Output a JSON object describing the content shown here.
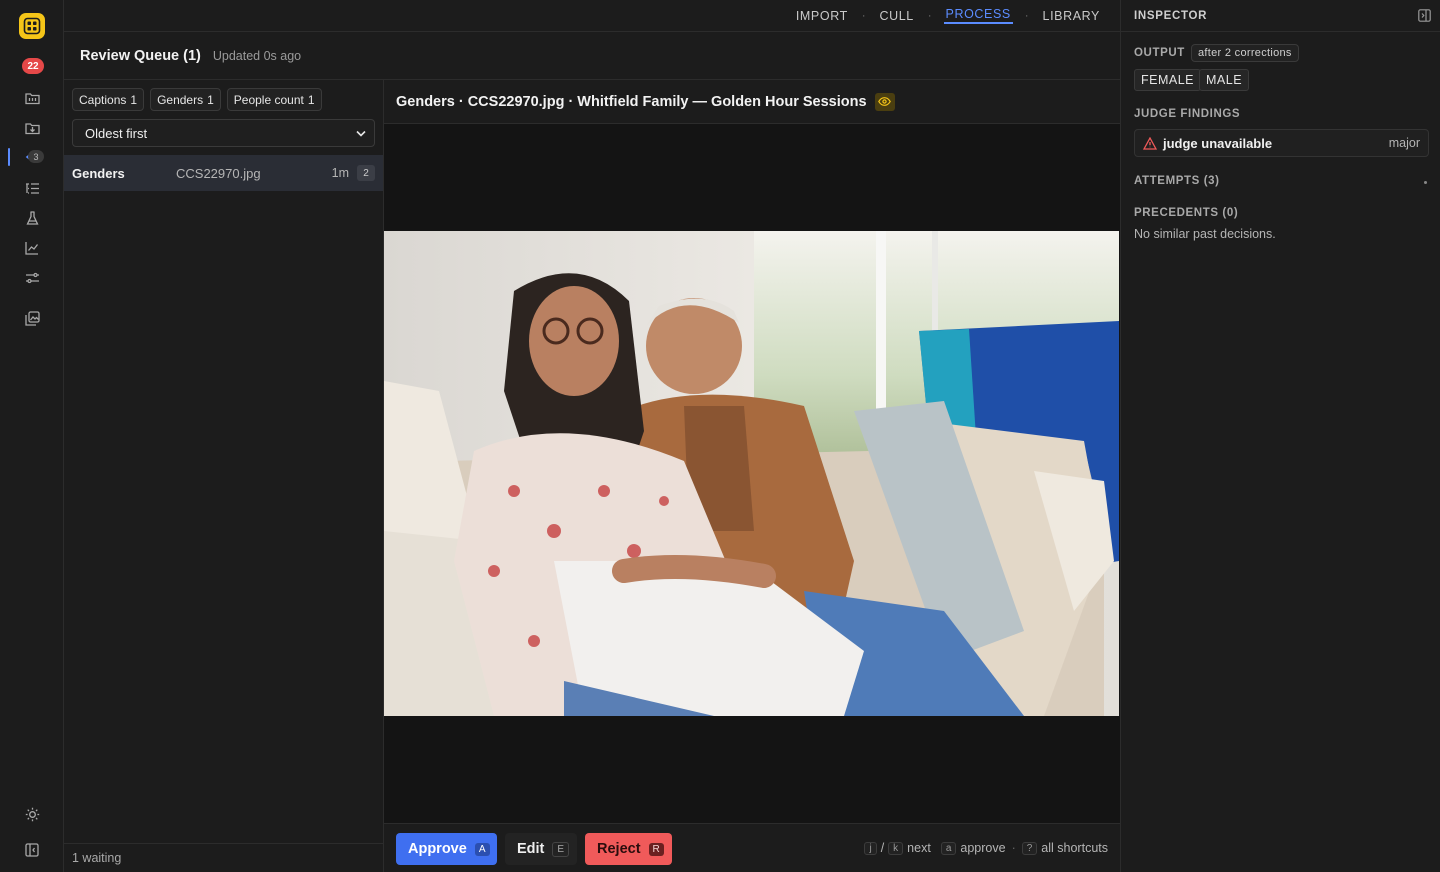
{
  "rail": {
    "notification_count": "22",
    "process_count": "3",
    "colors": {
      "logo": "#f5c518",
      "badge": "#e54848",
      "accent": "#5b8cff"
    },
    "icons": [
      "grid-logo-icon",
      "folder-icon",
      "import-icon",
      "process-icon",
      "list-icon",
      "flask-icon",
      "chart-icon",
      "sliders-icon",
      "gallery-icon",
      "sun-icon",
      "panel-toggle-icon"
    ]
  },
  "topnav": {
    "items": [
      "IMPORT",
      "CULL",
      "PROCESS",
      "LIBRARY"
    ],
    "active": "PROCESS",
    "separator": "·"
  },
  "queue_header": {
    "title": "Review Queue (1)",
    "updated": "Updated 0s ago"
  },
  "queue": {
    "chips": [
      {
        "label": "Captions",
        "count": "1"
      },
      {
        "label": "Genders",
        "count": "1"
      },
      {
        "label": "People count",
        "count": "1"
      }
    ],
    "sort": {
      "selected": "Oldest first"
    },
    "rows": [
      {
        "category": "Genders",
        "file": "CCS22970.jpg",
        "age": "1m",
        "count": "2",
        "selected": true
      }
    ],
    "footer": "1 waiting"
  },
  "viewer": {
    "title": "Genders · CCS22970.jpg · Whitfield Family — Golden Hour Sessions",
    "actions": {
      "approve": {
        "label": "Approve",
        "key": "A"
      },
      "edit": {
        "label": "Edit",
        "key": "E"
      },
      "reject": {
        "label": "Reject",
        "key": "R"
      }
    },
    "shortcuts": {
      "nav_keys": [
        "j",
        "k"
      ],
      "nav_sep": "/",
      "nav_label": "next",
      "approve_key": "a",
      "approve_label": "approve",
      "all_key": "?",
      "all_label": "all shortcuts",
      "dot": "·"
    }
  },
  "inspector": {
    "title": "INSPECTOR",
    "output": {
      "label": "OUTPUT",
      "corrections": "after 2 corrections",
      "tags": [
        "FEMALE",
        "MALE"
      ]
    },
    "judge": {
      "label": "JUDGE FINDINGS",
      "finding": "judge unavailable",
      "severity": "major"
    },
    "attempts": {
      "label": "ATTEMPTS (3)"
    },
    "precedents": {
      "label": "PRECEDENTS (0)",
      "empty": "No similar past decisions."
    }
  }
}
